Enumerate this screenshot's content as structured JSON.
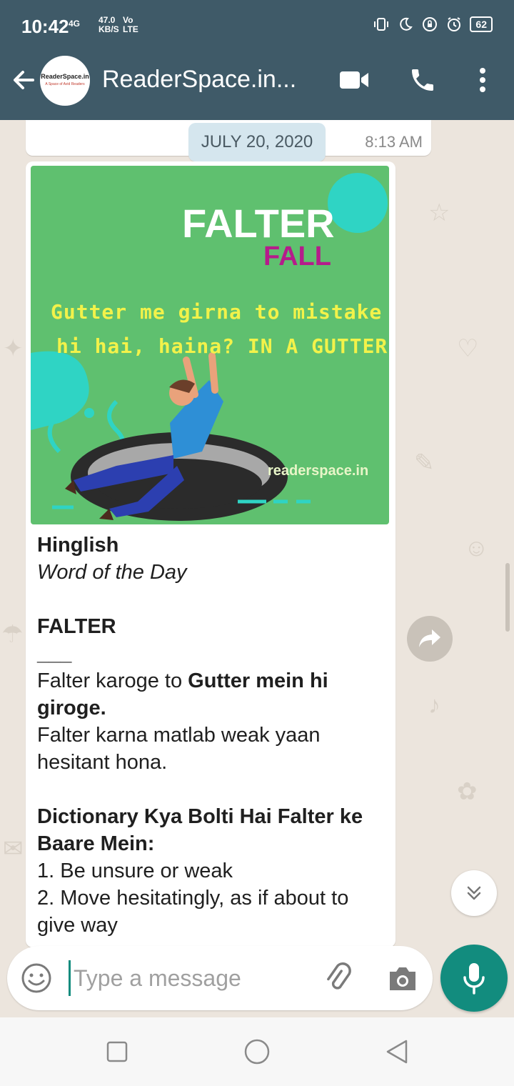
{
  "status": {
    "time": "10:42",
    "network": "4G",
    "speed": "47.0",
    "speed_unit": "KB/S",
    "vo": "Vo",
    "lte": "LTE",
    "battery": "62"
  },
  "header": {
    "title": "ReaderSpace.in...",
    "avatar_text": "ReaderSpace.in",
    "avatar_tagline": "A Space of Avid Readers"
  },
  "chat": {
    "prev_time": "8:13 AM",
    "date_chip": "JULY 20, 2020",
    "image": {
      "title": "FALTER",
      "subtitle": "FALL",
      "line1": "Gutter me girna to mistake",
      "line2": "hi hai, haina? IN A GUTTER",
      "site": "readerspace.in"
    },
    "text": {
      "heading": "Hinglish",
      "subheading": "Word of the Day",
      "word": "FALTER",
      "rule": "___",
      "line1_plain": "Falter karoge to ",
      "line1_bold": "Gutter mein hi giroge.",
      "line2": "Falter karna matlab weak yaan hesitant hona.",
      "dict_heading": "Dictionary Kya Bolti Hai Falter ke Baare Mein:",
      "def1": "1. Be unsure or weak",
      "def2": "2. Move hesitatingly, as if about to give way"
    }
  },
  "composer": {
    "placeholder": "Type a message"
  },
  "colors": {
    "header": "#3f5a68",
    "accent": "#128c7e",
    "image_bg": "#5fc06f"
  }
}
